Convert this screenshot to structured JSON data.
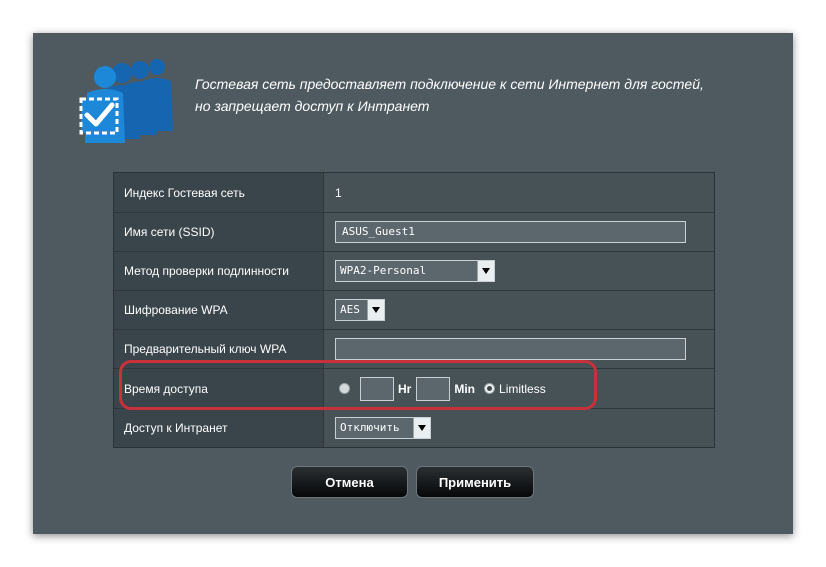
{
  "intro": {
    "line1": "Гостевая сеть предоставляет подключение к сети Интернет для гостей,",
    "line2": "но запрещает доступ к Интранет"
  },
  "settings": {
    "index": {
      "label": "Индекс Гостевая сеть",
      "value": "1"
    },
    "ssid": {
      "label": "Имя сети (SSID)",
      "value": "ASUS_Guest1"
    },
    "auth": {
      "label": "Метод проверки подлинности",
      "value": "WPA2-Personal"
    },
    "encryption": {
      "label": "Шифрование WPA",
      "value": "AES"
    },
    "psk": {
      "label": "Предварительный ключ WPA",
      "value": ""
    },
    "access_time": {
      "label": "Время доступа",
      "hr_label": "Hr",
      "min_label": "Min",
      "limitless_label": "Limitless",
      "selected": "limitless"
    },
    "intranet": {
      "label": "Доступ к Интранет",
      "value": "Отключить"
    }
  },
  "buttons": {
    "cancel": "Отмена",
    "apply": "Применить"
  },
  "colors": {
    "panel": "#4e5a60",
    "label_cell": "#39454b",
    "highlight": "#c8303a",
    "icon_blue": "#1e88d8"
  }
}
